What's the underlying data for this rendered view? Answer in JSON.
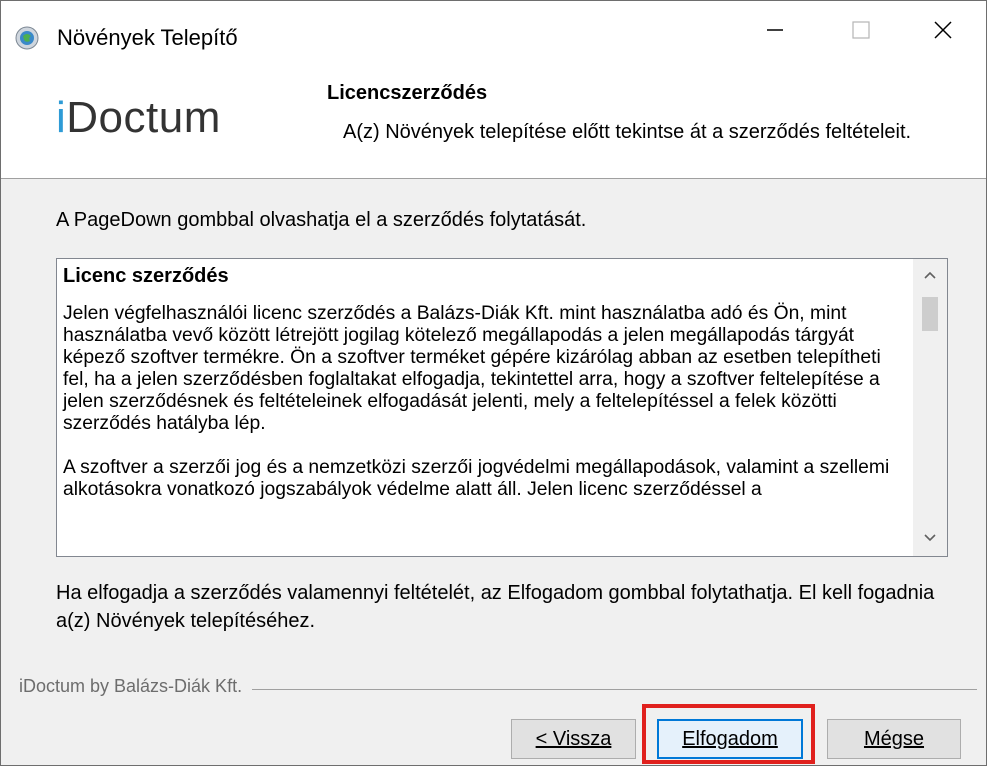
{
  "window": {
    "title": "Növények Telepítő",
    "icons": {
      "app": "installer-globe-icon",
      "minimize": "minimize-icon",
      "maximize": "maximize-icon",
      "close": "close-icon"
    }
  },
  "header": {
    "brand_i": "i",
    "brand_rest": "Doctum",
    "brand_color": "#2e9bd6",
    "title": "Licencszerződés",
    "subtitle": "A(z) Növények telepítése előtt tekintse át a szerződés feltételeit."
  },
  "instruction": "A PageDown gombbal olvashatja el a szerződés folytatását.",
  "license": {
    "heading": "Licenc szerződés",
    "paragraph1": "Jelen végfelhasználói licenc szerződés a Balázs-Diák Kft. mint használatba adó és Ön, mint használatba vevő között létrejött jogilag kötelező megállapodás a jelen megállapodás tárgyát képező szoftver termékre. Ön a szoftver terméket gépére kizárólag abban az esetben telepítheti fel, ha a jelen szerződésben foglaltakat elfogadja, tekintettel arra, hogy a szoftver feltelepítése a jelen szerződésnek és feltételeinek elfogadását jelenti, mely a feltelepítéssel a felek közötti szerződés hatályba lép.",
    "paragraph2": "A szoftver a szerzői jog és a nemzetközi szerzői jogvédelmi megállapodások, valamint a szellemi alkotásokra vonatkozó jogszabályok védelme alatt áll. Jelen licenc szerződéssel a",
    "scroll_icons": {
      "up": "chevron-up-icon",
      "down": "chevron-down-icon"
    }
  },
  "accept_text": "Ha elfogadja a szerződés valamennyi feltételét, az Elfogadom gombbal folytathatja. El kell fogadnia a(z) Növények telepítéséhez.",
  "footer": {
    "brand": "iDoctum by Balázs-Diák Kft.",
    "buttons": {
      "back": "< Vissza",
      "accept": "Elfogadom",
      "cancel": "Mégse"
    }
  },
  "highlight_color": "#e0201d"
}
